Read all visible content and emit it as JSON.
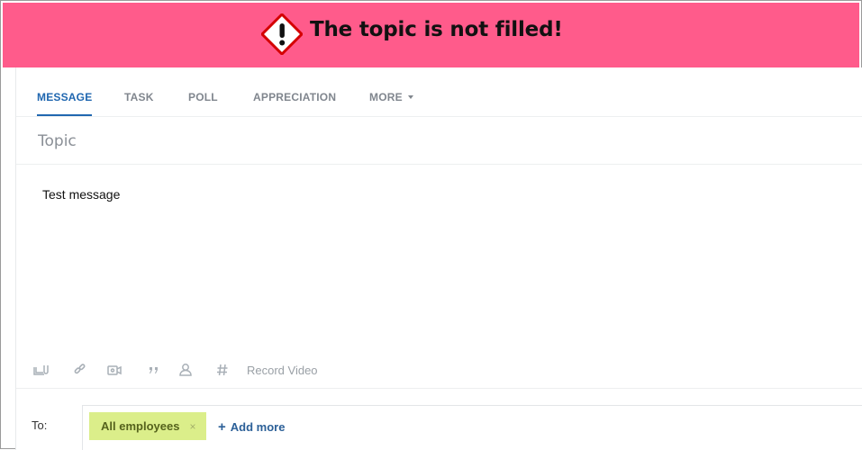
{
  "banner": {
    "message": "The topic is not filled!",
    "background": "#ff5b8b",
    "icon": "warning-diamond-icon"
  },
  "tabs": [
    {
      "label": "MESSAGE",
      "active": true
    },
    {
      "label": "TASK",
      "active": false
    },
    {
      "label": "POLL",
      "active": false
    },
    {
      "label": "APPRECIATION",
      "active": false
    },
    {
      "label": "MORE",
      "active": false,
      "dropdown": true
    }
  ],
  "topic": {
    "placeholder": "Topic",
    "value": ""
  },
  "editor": {
    "text": "Test message"
  },
  "toolbar": {
    "icons": [
      "attach-file-icon",
      "link-icon",
      "video-icon",
      "quote-icon",
      "mention-icon",
      "hashtag-icon"
    ],
    "record_video_label": "Record Video"
  },
  "recipients": {
    "to_label": "To:",
    "chips": [
      {
        "label": "All employees",
        "remove": "×"
      }
    ],
    "add_more_plus": "+",
    "add_more_label": "Add more"
  },
  "colors": {
    "accent": "#2067b0",
    "chip_background": "#dbee8a",
    "link": "#2c6098"
  }
}
